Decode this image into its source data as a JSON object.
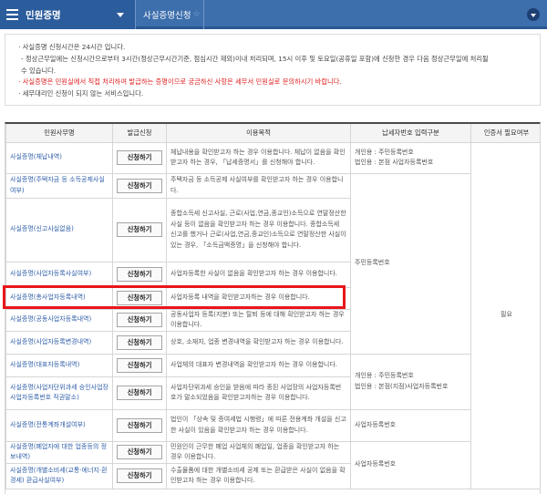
{
  "header": {
    "menu_title": "민원증명",
    "breadcrumb": "사실증명신청",
    "breadcrumb_star": "☆"
  },
  "notice": {
    "lines": [
      "ㆍ사실증명 신청시간은 24시간 입니다.",
      "- 정상근무일에는 신청시간으로부터 3시간(정상근무시간기준, 점심시간 제외)이내 처리되며, 15시 이후 및 토요일(공휴일 포함)에 신청한 경우 다음 정상근무일에 처리될",
      "수 있습니다.",
      "ㆍ사실증명은 민원실에서 직접 처리하여 발급하는 증명이므로 궁금하신 사항은 세무서 민원실로 문의하시기 바랍니다.",
      "ㆍ세무대리인 신청이 되지 않는 서비스입니다."
    ]
  },
  "table": {
    "headers": [
      "민원사무명",
      "발급신청",
      "이용목적",
      "납세자번호 입력구분",
      "인증서 필요여부"
    ],
    "apply_label": "신청하기",
    "rows": [
      {
        "name": "사실증명(체납내역)",
        "purpose": "체납내용을 확인받고자 하는 경우 이용합니다. 체납이 없음을 확인받고자 하는 경우, 「납세증명서」를 신청해야 합니다."
      },
      {
        "name": "사실증명(주택자금 등 소득공제사실여부)",
        "purpose": "주택자금 등 소득공제 사실여부를 확인받고자 하는 경우 이용합니다."
      },
      {
        "name": "사실증명(신고사실없음)",
        "purpose": "종합소득세 신고사실, 근로(사업,연금,종교인)소득으로 연말정산한 사실 등이 없음을 확인받고자 하는 경우 이용합니다. 종합소득세 신고를 했거나 근로(사업,연금,종교인)소득으로 연말정산한 사실이 있는 경우, 「소득금액증명」을 신청해야 합니다."
      },
      {
        "name": "사실증명(사업자등록사실여부)",
        "purpose": "사업자등록한 사실이 없음을 확인받고자 하는 경우 이용합니다."
      },
      {
        "name": "사실증명(총사업자등록내역)",
        "purpose": "사업자등록 내역을 확인받고자하는 경우 이용합니다."
      },
      {
        "name": "사실증명(공동사업자등록내역)",
        "purpose": "공동사업자 등록(지분) 또는 탈퇴 등에 대해 확인받고자 하는 경우 이용합니다."
      },
      {
        "name": "사실증명(사업자등록변경내역)",
        "purpose": "상호, 소재지, 업종 변경내역을 확인받고자 하는 경우 이용합니다."
      },
      {
        "name": "사실증명(대표자등록내역)",
        "purpose": "사업체의 대표자 변경내역을 확인받고자 하는 경우 이용합니다."
      },
      {
        "name": "사실증명(사업자단위과세 승인사업장사업자등록번호 직권말소)",
        "purpose": "사업자단위과세 승인을 받음에 따라 종된 사업장의 사업자등록번호가 말소되었음을 확인받고자하는 경우 이용합니다."
      },
      {
        "name": "사실증명(전통계좌개설여부)",
        "purpose": "법인이 「상속 및 증여세법 시행령」에 따른 전용계좌 개설을 신고한 사실이 있음을 확인받고자 하는 경우 이용합니다."
      },
      {
        "name": "사실증명(폐업자에 대한 업종등의 정보내역)",
        "purpose": "민원인이 근무한 폐업 사업체의 폐업일, 업종을 확인받고자 하는 경우 이용합니다."
      },
      {
        "name": "사실증명(개별소비세(교통·에너지·환경세) 환급사실여부)",
        "purpose": "수출물품에 대한 개별소비세 공제 또는 환급받은 사실이 없음을 확인받고자 하는 경우 이용합니다."
      }
    ],
    "input_types": {
      "g1": "개인용 : 주민등록번호\n법인용 : 본점 사업자등록번호",
      "g2": "주민등록번호",
      "g3": "개인용 : 주민등록번호\n법인용 : 본점(지점)사업자등록번호",
      "g4": "사업자등록번호",
      "g5": "사업자등록번호"
    },
    "cert_required": "필요"
  }
}
